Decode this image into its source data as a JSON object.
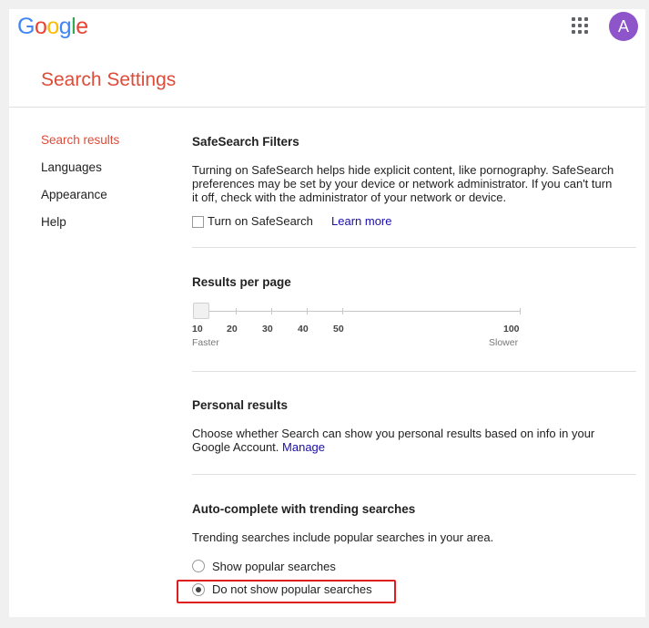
{
  "header": {
    "logo_letters": [
      "G",
      "o",
      "o",
      "g",
      "l",
      "e"
    ],
    "avatar_letter": "A",
    "apps_icon": "apps-grid-icon"
  },
  "page": {
    "title": "Search Settings"
  },
  "nav": {
    "items": [
      {
        "label": "Search results",
        "active": true
      },
      {
        "label": "Languages",
        "active": false
      },
      {
        "label": "Appearance",
        "active": false
      },
      {
        "label": "Help",
        "active": false
      }
    ]
  },
  "safesearch": {
    "title": "SafeSearch Filters",
    "description": "Turning on SafeSearch helps hide explicit content, like pornography. SafeSearch preferences may be set by your device or network administrator. If you can't turn it off, check with the administrator of your network or device.",
    "checkbox_label": "Turn on SafeSearch",
    "checked": false,
    "learn_more": "Learn more"
  },
  "results_per_page": {
    "title": "Results per page",
    "ticks": [
      "10",
      "20",
      "30",
      "40",
      "50",
      "100"
    ],
    "selected": "10",
    "left_caption": "Faster",
    "right_caption": "Slower"
  },
  "personal_results": {
    "title": "Personal results",
    "description": "Choose whether Search can show you personal results based on info in your Google Account.",
    "manage_link": "Manage"
  },
  "autocomplete": {
    "title": "Auto-complete with trending searches",
    "description": "Trending searches include popular searches in your area.",
    "options": [
      {
        "label": "Show popular searches",
        "checked": false
      },
      {
        "label": "Do not show popular searches",
        "checked": true
      }
    ]
  },
  "colors": {
    "accent_red": "#dd4b39",
    "link_blue": "#1a0dab",
    "highlight_border": "#e01e1e",
    "avatar": "#8e54c9"
  }
}
